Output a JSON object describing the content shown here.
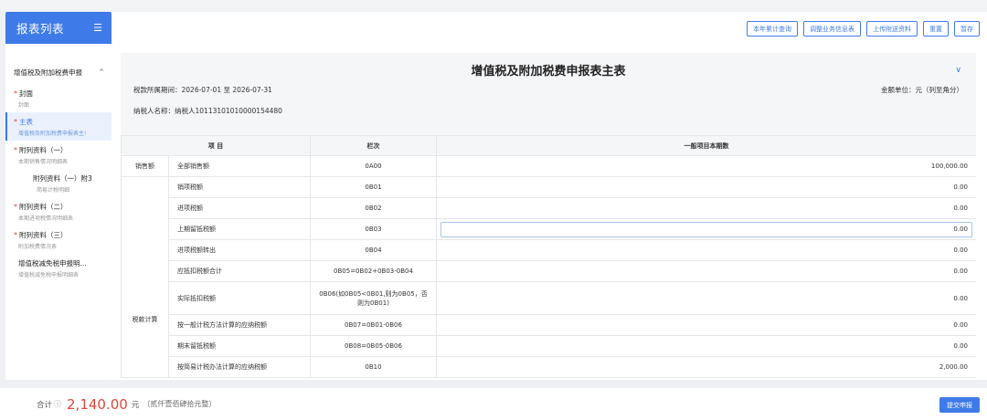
{
  "sidebar": {
    "title": "报表列表",
    "menu_icon": "☰",
    "group": {
      "label": "增值税及附加税费申报",
      "chevron": "^"
    },
    "items": [
      {
        "label": "封面",
        "sub": "封面",
        "required": "*"
      },
      {
        "label": "主表",
        "sub": "增值税及附加税费申报表主!",
        "required": "*"
      },
      {
        "label": "附列资料（一）",
        "sub": "本期销售情况明细表",
        "required": "*"
      },
      {
        "label": "附列资料（一）附3",
        "sub": "简易计税明细"
      },
      {
        "label": "附列资料（二）",
        "sub": "本期进项税情况明细表",
        "required": "*"
      },
      {
        "label": "附列资料（三）",
        "sub": "附加税费情况表",
        "required": "*"
      },
      {
        "label": "增值税减免税申报明...",
        "sub": "增值税减免税申报明细表"
      }
    ]
  },
  "toolbar": {
    "buttons": [
      "本年累计查询",
      "调整业务信息表",
      "上传附送资料",
      "重置",
      "暂存"
    ]
  },
  "form": {
    "title": "增值税及附加税费申报表主表",
    "collapse_icon": "∨",
    "period": "税款所属期间：2026-07-01 至 2026-07-31",
    "unit": "金额单位：元（列至角分）",
    "taxpayer": "纳税人名称：纳税人10113101010000154480"
  },
  "table": {
    "headers": [
      "项 目",
      "栏次",
      "一般项目本期数"
    ],
    "categories": {
      "sales": "销售额",
      "tax_calc": "税款计算"
    },
    "rows": [
      {
        "item": "全部销售额",
        "code": "0A00",
        "value": "100,000.00"
      },
      {
        "item": "销项税额",
        "code": "0B01",
        "value": "0.00"
      },
      {
        "item": "进项税额",
        "code": "0B02",
        "value": "0.00"
      },
      {
        "item": "上期留抵税额",
        "code": "0B03",
        "value": "0.00"
      },
      {
        "item": "进项税额转出",
        "code": "0B04",
        "value": "0.00"
      },
      {
        "item": "应抵扣税额合计",
        "code": "0B05=0B02+0B03-0B04",
        "value": "0.00"
      },
      {
        "item": "实际抵扣税额",
        "code": "0B06(如0B05<0B01,则为0B05，否则为0B01)",
        "value": "0.00"
      },
      {
        "item": "按一般计税方法计算的应纳税额",
        "code": "0B07=0B01-0B06",
        "value": "0.00"
      },
      {
        "item": "期末留抵税额",
        "code": "0B08=0B05-0B06",
        "value": "0.00"
      },
      {
        "item": "按简易计税办法计算的应纳税额",
        "code": "0B10",
        "value": "2,000.00"
      }
    ]
  },
  "footer": {
    "total_label": "合计",
    "info_icon": "ⓘ",
    "total_value": "2,140.00",
    "total_unit": "元",
    "total_words": "（贰仟壹佰肆拾元整）",
    "submit_label": "提交申报"
  }
}
